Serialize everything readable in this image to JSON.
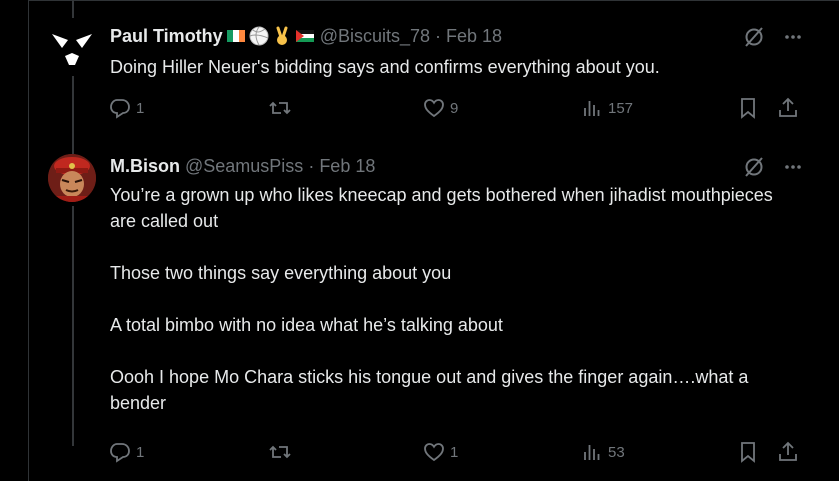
{
  "tweets": [
    {
      "name": "Paul Timothy",
      "handle": "@Biscuits_78",
      "separator": "·",
      "date": "Feb 18",
      "text": "Doing Hiller Neuer's bidding says and confirms everything about you.",
      "replies": "1",
      "retweets": "",
      "likes": "9",
      "views": "157"
    },
    {
      "name": "M.Bison",
      "handle": "@SeamusPiss",
      "separator": "·",
      "date": "Feb 18",
      "text": "You’re a grown up who likes kneecap and gets bothered when jihadist mouthpieces are called out\n\nThose two things say everything about you\n\nA total bimbo with no idea what he’s talking about\n\nOooh I hope Mo Chara sticks his tongue out and gives the finger again….what a bender",
      "replies": "1",
      "retweets": "",
      "likes": "1",
      "views": "53"
    }
  ],
  "icons": {
    "grok": "grok-icon",
    "more": "more-icon",
    "reply": "reply-icon",
    "retweet": "retweet-icon",
    "like": "heart-icon",
    "views": "views-icon",
    "bookmark": "bookmark-icon",
    "share": "share-icon"
  },
  "colors": {
    "background": "#000000",
    "text": "#e7e9ea",
    "secondary": "#71767b",
    "border": "#2f3336"
  }
}
